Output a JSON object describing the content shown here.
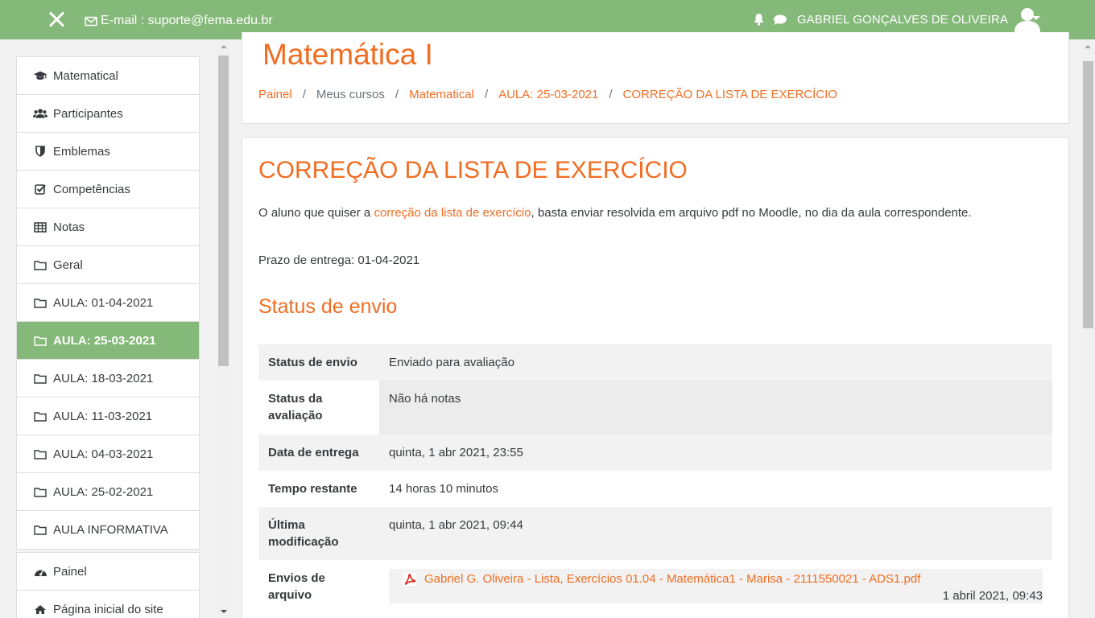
{
  "header": {
    "email_label": "E-mail : suporte@fema.edu.br",
    "user_name": "GABRIEL GONÇALVES DE OLIVEIRA"
  },
  "sidebar": {
    "course_items": [
      {
        "label": "Matematical",
        "icon": "graduation-cap-icon"
      },
      {
        "label": "Participantes",
        "icon": "users-icon"
      },
      {
        "label": "Emblemas",
        "icon": "shield-icon"
      },
      {
        "label": "Competências",
        "icon": "check-square-icon"
      },
      {
        "label": "Notas",
        "icon": "table-icon"
      },
      {
        "label": "Geral",
        "icon": "folder-icon"
      },
      {
        "label": "AULA: 01-04-2021",
        "icon": "folder-icon"
      },
      {
        "label": "AULA: 25-03-2021",
        "icon": "folder-icon",
        "active": true
      },
      {
        "label": "AULA: 18-03-2021",
        "icon": "folder-icon"
      },
      {
        "label": "AULA: 11-03-2021",
        "icon": "folder-icon"
      },
      {
        "label": "AULA: 04-03-2021",
        "icon": "folder-icon"
      },
      {
        "label": "AULA: 25-02-2021",
        "icon": "folder-icon"
      },
      {
        "label": "AULA INFORMATIVA",
        "icon": "folder-icon"
      }
    ],
    "site_items": [
      {
        "label": "Painel",
        "icon": "dashboard-icon"
      },
      {
        "label": "Página inicial do site",
        "icon": "home-icon"
      }
    ]
  },
  "page": {
    "title": "Matemática I",
    "breadcrumb": [
      {
        "label": "Painel",
        "link": true
      },
      {
        "label": "Meus cursos",
        "link": false
      },
      {
        "label": "Matematical",
        "link": true
      },
      {
        "label": "AULA: 25-03-2021",
        "link": true
      },
      {
        "label": "CORREÇÃO DA LISTA DE EXERCÍCIO",
        "link": true
      }
    ]
  },
  "activity": {
    "title": "CORREÇÃO DA LISTA DE EXERCÍCIO",
    "intro_before": "O aluno que quiser a ",
    "intro_link": "correção da lista de exercício",
    "intro_after": ", basta enviar resolvida em arquivo pdf no Moodle, no dia da aula correspondente.",
    "deadline": "Prazo de entrega: 01-04-2021",
    "status_heading": "Status de envio",
    "status_rows": [
      {
        "key": "Status de envio",
        "value": "Enviado para avaliação"
      },
      {
        "key": "Status da avaliação",
        "value": "Não há notas"
      },
      {
        "key": "Data de entrega",
        "value": "quinta, 1 abr 2021, 23:55"
      },
      {
        "key": "Tempo restante",
        "value": "14 horas 10 minutos"
      },
      {
        "key": "Última modificação",
        "value": "quinta, 1 abr 2021, 09:44"
      },
      {
        "key": "Envios de arquivo",
        "value": ""
      }
    ],
    "file": {
      "name": "Gabriel G. Oliveira - Lista, Exercícios 01.04 - Matemática1 - Marisa - 2111550021 - ADS1.pdf",
      "date": "1 abril 2021, 09:43",
      "icon": "pdf-icon"
    }
  },
  "colors": {
    "navbar": "#85b97a",
    "accent": "#f06d22"
  }
}
